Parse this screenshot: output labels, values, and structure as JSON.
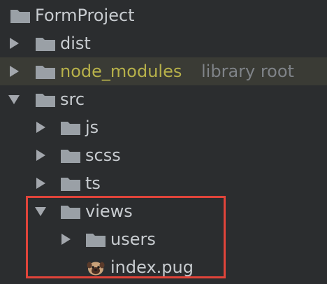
{
  "project": {
    "name": "FormProject"
  },
  "items": [
    {
      "label": "dist"
    },
    {
      "label": "node_modules",
      "suffix": "library root"
    },
    {
      "label": "src"
    },
    {
      "label": "js"
    },
    {
      "label": "scss"
    },
    {
      "label": "ts"
    },
    {
      "label": "views"
    },
    {
      "label": "users"
    },
    {
      "label": "index.pug"
    }
  ],
  "colors": {
    "background": "#2b2d2f",
    "text": "#c8ccd0",
    "excluded": "#b7b14a",
    "muted": "#7f8388",
    "folder": "#9aa0a6",
    "highlight_border": "#e0443a"
  },
  "icons": {
    "folder": "folder-icon",
    "expand": "chevron-right-icon",
    "collapse": "chevron-down-icon",
    "pug": "pug-file-icon"
  }
}
